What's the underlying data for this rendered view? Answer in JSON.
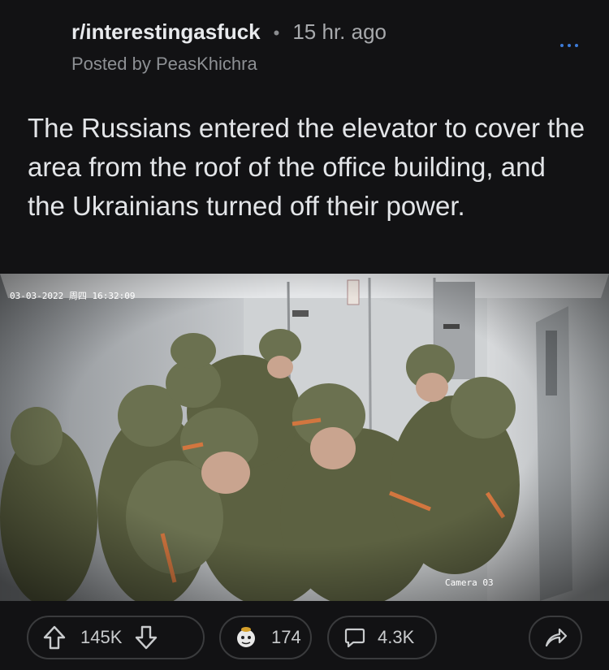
{
  "post": {
    "subreddit": "r/interestingasfuck",
    "separator": "•",
    "age": "15 hr. ago",
    "posted_by": "Posted by PeasKhichra",
    "title": "The Russians entered the elevator to cover the area from the roof of the office building, and the Ukrainians turned off their power."
  },
  "image": {
    "timestamp_overlay": "03-03-2022 周四 16:32:09",
    "camera_label": "Camera 03"
  },
  "actions": {
    "upvotes": "145K",
    "awards": "174",
    "comments": "4.3K"
  },
  "icons": {
    "more": "more-options-icon",
    "upvote": "upvote-arrow-icon",
    "downvote": "downvote-arrow-icon",
    "award": "award-icon",
    "comment": "comment-bubble-icon",
    "share": "share-arrow-icon"
  },
  "colors": {
    "background": "#121214",
    "accent": "#3d7bd8",
    "pill_border": "#3a3b3d"
  }
}
